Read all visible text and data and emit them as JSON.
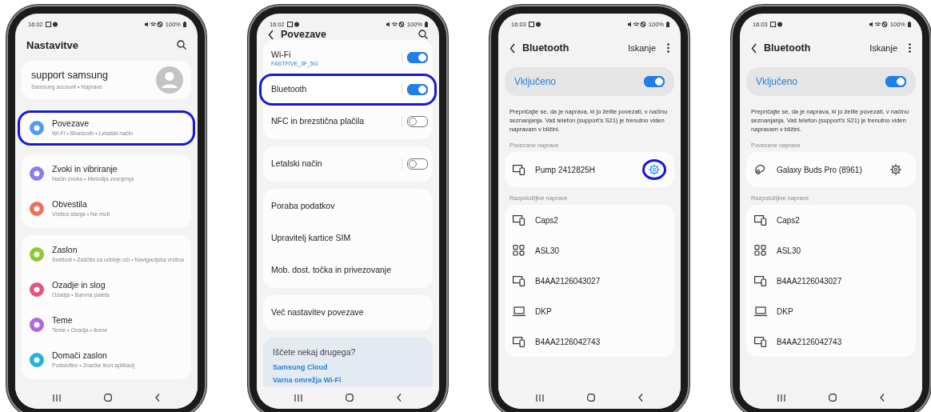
{
  "phones": [
    {
      "kind": "settings",
      "status_bar": {
        "time": "16:02",
        "battery": "100%"
      },
      "title": "Nastavitve",
      "account": {
        "name": "support samsung",
        "subtitle": "Samsung account • Naprave"
      },
      "groups": [
        {
          "items": [
            {
              "title": "Povezave",
              "subtitle": "Wi-Fi • Bluetooth • Letalski način",
              "color": "#4f9cf2",
              "highlight": true
            }
          ]
        },
        {
          "items": [
            {
              "title": "Zvoki in vibriranje",
              "subtitle": "Način zvoka • Melodija zvonjenja",
              "color": "#8b7cf0",
              "highlight": false
            },
            {
              "title": "Obvestila",
              "subtitle": "Vrstica stanja • Ne moti",
              "color": "#f0705c",
              "highlight": false
            }
          ]
        },
        {
          "items": [
            {
              "title": "Zaslon",
              "subtitle": "Svetlost • Zaščita za udobje oči • Navigacijska vrstica",
              "color": "#8acb2e",
              "highlight": false
            },
            {
              "title": "Ozadje in slog",
              "subtitle": "Ozadja • Barvna paleta",
              "color": "#e8527c",
              "highlight": false
            },
            {
              "title": "Teme",
              "subtitle": "Teme • Ozadja • Ikone",
              "color": "#b06ad8",
              "highlight": false
            },
            {
              "title": "Domači zaslon",
              "subtitle": "Postavitev • Značke ikon aplikacij",
              "color": "#22b2da",
              "highlight": false
            }
          ]
        }
      ]
    },
    {
      "kind": "connections",
      "status_bar": {
        "time": "16:02",
        "battery": "100%"
      },
      "title": "Povezave",
      "groups": [
        {
          "items": [
            {
              "kind": "toggle",
              "title": "Wi-Fi",
              "subtitle": "FASTFIVE_3F_5G",
              "on": true,
              "highlight": false
            },
            {
              "kind": "toggle",
              "title": "Bluetooth",
              "on": true,
              "highlight": true
            },
            {
              "kind": "toggle",
              "title": "NFC in brezstična plačila",
              "on": false,
              "highlight": false
            }
          ]
        },
        {
          "items": [
            {
              "kind": "toggle",
              "title": "Letalski način",
              "on": false,
              "highlight": false
            }
          ]
        },
        {
          "items": [
            {
              "kind": "link",
              "title": "Poraba podatkov",
              "highlight": false
            },
            {
              "kind": "link",
              "title": "Upravitelj kartice SIM",
              "highlight": false
            },
            {
              "kind": "link",
              "title": "Mob. dost. točka in privezovanje",
              "highlight": false
            }
          ]
        },
        {
          "items": [
            {
              "kind": "link",
              "title": "Več nastavitev povezave",
              "highlight": false
            }
          ]
        }
      ],
      "suggestions": {
        "title": "Iščete nekaj drugega?",
        "links": [
          "Samsung Cloud",
          "Varna omrežja Wi-Fi"
        ]
      }
    },
    {
      "kind": "bluetooth",
      "status_bar": {
        "time": "16:03",
        "battery": "100%"
      },
      "title": "Bluetooth",
      "action": "Iskanje",
      "master": {
        "label": "Vključeno",
        "on": true
      },
      "description": "Prepričajte se, da je naprava, ki jo želite povezati, v načinu seznanjanja. Vaš telefon (support's S21) je trenutno viden napravam v bližini.",
      "paired_label": "Povezane naprave",
      "paired": [
        {
          "name": "Pump 2412825H",
          "kind": "devices",
          "highlight": true
        }
      ],
      "available_label": "Razpoložljive naprave",
      "available": [
        {
          "name": "Caps2",
          "kind": "devices"
        },
        {
          "name": "ASL30",
          "kind": "grid"
        },
        {
          "name": "B4AA2126043027",
          "kind": "devices"
        },
        {
          "name": "DKP",
          "kind": "laptop"
        },
        {
          "name": "B4AA2126042743",
          "kind": "devices"
        }
      ]
    },
    {
      "kind": "bluetooth",
      "status_bar": {
        "time": "16:03",
        "battery": "100%"
      },
      "title": "Bluetooth",
      "action": "Iskanje",
      "master": {
        "label": "Vključeno",
        "on": true
      },
      "description": "Prepričajte se, da je naprava, ki jo želite povezati, v načinu seznanjanja. Vaš telefon (support's S21) je trenutno viden napravam v bližini.",
      "paired_label": "Povezane naprave",
      "paired": [
        {
          "name": "Galaxy Buds Pro (8961)",
          "kind": "earbuds",
          "highlight": false
        }
      ],
      "available_label": "Razpoložljive naprave",
      "available": [
        {
          "name": "Caps2",
          "kind": "devices"
        },
        {
          "name": "ASL30",
          "kind": "grid"
        },
        {
          "name": "B4AA2126043027",
          "kind": "devices"
        },
        {
          "name": "DKP",
          "kind": "laptop"
        },
        {
          "name": "B4AA2126042743",
          "kind": "devices"
        }
      ]
    }
  ]
}
